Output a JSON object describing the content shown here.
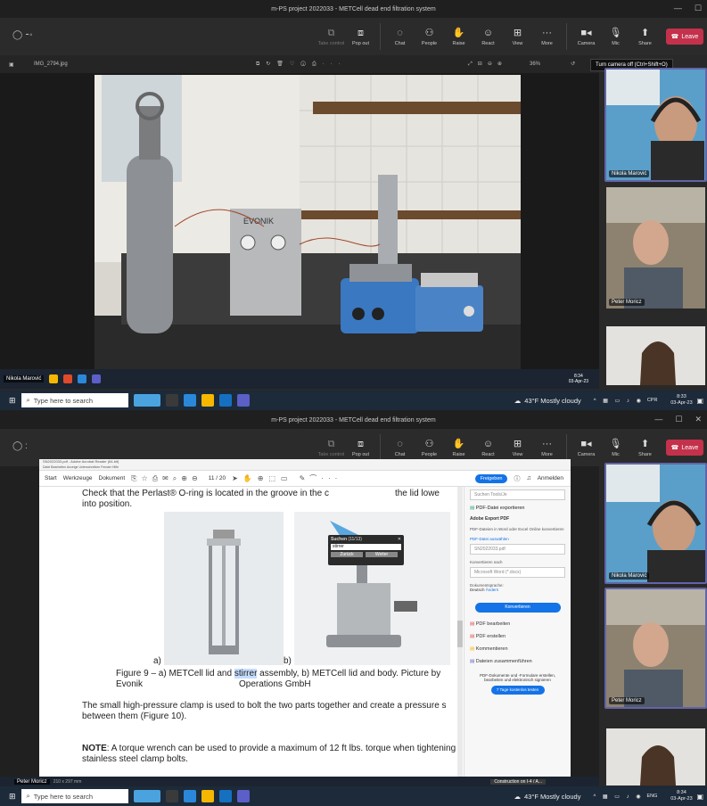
{
  "app": {
    "window_title": "m-PS project 2022033 - METCell dead end filtration system",
    "toolbar": [
      {
        "label": "Take control",
        "icon": "cast-icon",
        "dim": true
      },
      {
        "label": "Pop out",
        "icon": "popout-icon"
      },
      {
        "label": "Chat",
        "icon": "chat-icon"
      },
      {
        "label": "People",
        "icon": "people-icon"
      },
      {
        "label": "Raise",
        "icon": "hand-icon"
      },
      {
        "label": "React",
        "icon": "smile-icon"
      },
      {
        "label": "View",
        "icon": "grid-icon"
      },
      {
        "label": "More",
        "icon": "more-icon"
      }
    ],
    "camera_label": "Camera",
    "mic_label": "Mic",
    "share_label": "Share",
    "leave_label": "Leave"
  },
  "panel1": {
    "file_name": "IMG_2794.jpg",
    "zoom": "36%",
    "tooltip": "Turn camera off (Ctrl+Shift+O)",
    "device_brand": "EVONIK",
    "presenter": "Nikola Marović",
    "local_clock": [
      "8:34",
      "03-Apr-23"
    ]
  },
  "participants": [
    {
      "name": "Nikola Marović"
    },
    {
      "name": "Peter Moricz"
    },
    {
      "name": ""
    }
  ],
  "taskbar": {
    "search_placeholder": "Type here to search",
    "weather": "43°F  Mostly cloudy",
    "lang": "CPR",
    "lang2": "ENG",
    "time1": "8:33",
    "date1": "03-Apr-23",
    "time2": "8:34",
    "date2": "03-Apr-23"
  },
  "panel2": {
    "pdf_title": "SN2022033.pdf - Adobe Acrobat Reader (64-bit)",
    "menu": "Datei  Bearbeiten  Anzeige  Unterschreiben  Fenster  Hilfe",
    "tabs": [
      "Start",
      "Werkzeuge",
      "Dokument"
    ],
    "page": "11 / 20",
    "share_button": "Freigeben",
    "signin": "Anmelden",
    "find": {
      "title": "Suchen",
      "count": "(11/13)",
      "query": "stirrer",
      "prev": "Zurück",
      "next": "Weiter"
    },
    "doc": {
      "line1": "Check that the Perlast® O-ring is located in the groove in the c",
      "line1b": "the lid lowe",
      "line2": "into position.",
      "label_a": "a)",
      "label_b": "b)",
      "caption_pre": "Figure 9 – a) METCell lid and ",
      "caption_hl": "stirrer",
      "caption_post": " assembly, b) METCell lid and body. Picture by Evonik",
      "caption2": "Operations GmbH",
      "para1": "The small high-pressure clamp is used to bolt the two parts together and create a pressure s",
      "para1b": "between them (Figure 10).",
      "note_bold": "NOTE",
      "note": ": A torque wrench can be used to provide a maximum of 12 ft lbs. torque when tightening",
      "note2": "stainless steel clamp bolts."
    },
    "side": {
      "search": "Suchen Tools/Je",
      "export": "PDF-Datei exportieren",
      "adobe_export": "Adobe Export PDF",
      "desc": "PDF-Dateien in Word oder Excel Online konvertieren",
      "choose": "PDF-Datei auswählen",
      "file": "SN2022033.pdf",
      "convert_to": "Konvertieren nach",
      "format": "Microsoft Word (*.docx)",
      "lang_label": "Dokumentsprache:",
      "lang_val": "Deutsch",
      "lang_change": "Ändern",
      "convert_btn": "Konvertieren",
      "edit": "PDF bearbeiten",
      "create": "PDF erstellen",
      "comment": "Kommentieren",
      "combine": "Dateien zusammenführen",
      "promo": "PDF-Dokumente und -Formulare erstellen, bearbeiten und elektronisch signieren",
      "trial": "7 Tage kostenlos testen"
    },
    "presenter": "Peter Moricz",
    "status": "210 x 297 mm",
    "notif": "Construction on I-4 / A..."
  }
}
